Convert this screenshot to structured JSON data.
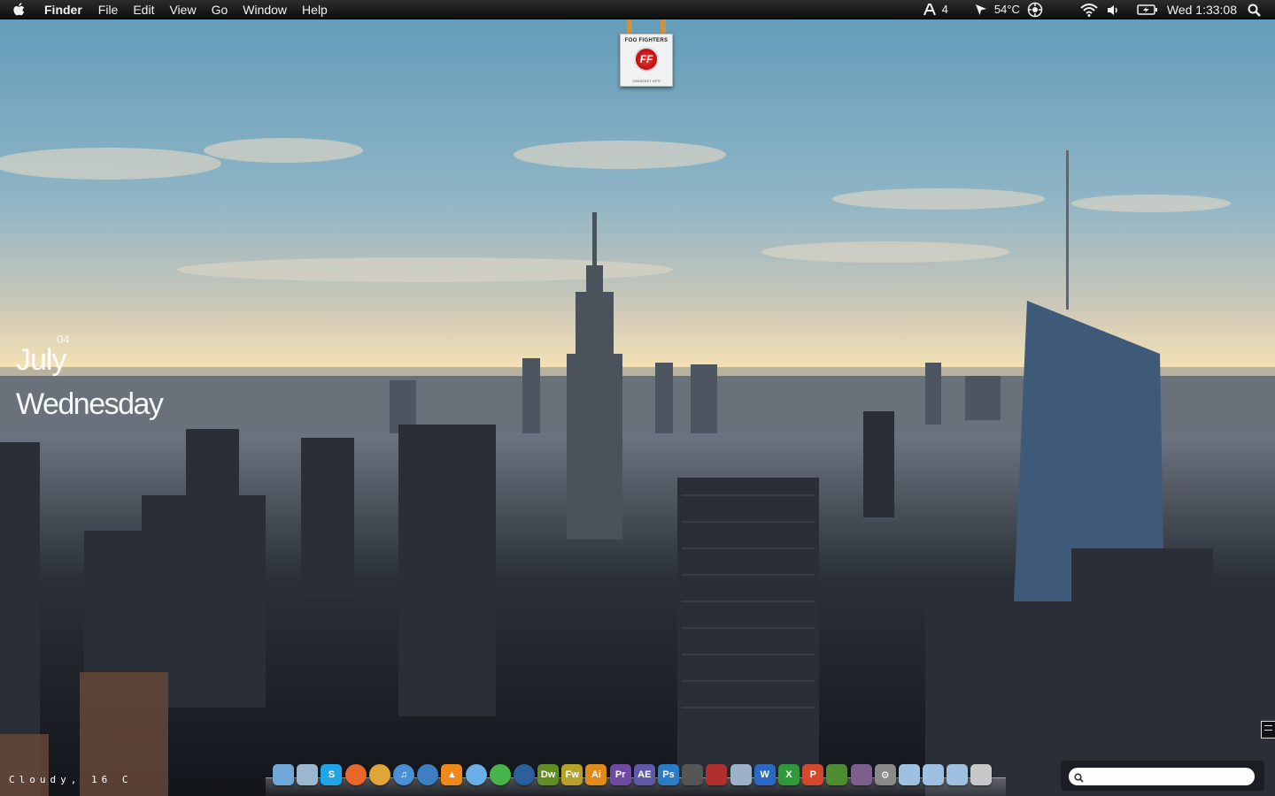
{
  "menubar": {
    "app_name": "Finder",
    "menus": [
      "File",
      "Edit",
      "View",
      "Go",
      "Window",
      "Help"
    ],
    "status": {
      "workspace_count": "4",
      "temperature": "54°C",
      "clock": "Wed 1:33:08"
    },
    "icons": [
      "apple-icon",
      "workspace-icon",
      "cursor-icon",
      "sensor-icon",
      "wifi-icon",
      "volume-icon",
      "battery-icon",
      "spotlight-icon"
    ]
  },
  "album": {
    "band": "FOO FIGHTERS",
    "title": "GREATEST HITS",
    "badge": "FF"
  },
  "date_widget": {
    "month": "July",
    "day": "04",
    "weekday": "Wednesday"
  },
  "weather": {
    "text": "Cloudy, 16 C"
  },
  "dock": {
    "items": [
      {
        "name": "finder",
        "label": "",
        "color": "#6fa7d8"
      },
      {
        "name": "mail",
        "label": "",
        "color": "#9bb6cf"
      },
      {
        "name": "skype",
        "label": "S",
        "color": "#1fa5e8"
      },
      {
        "name": "firefox",
        "label": "",
        "color": "#e7682a"
      },
      {
        "name": "chrome",
        "label": "",
        "color": "#dfa637"
      },
      {
        "name": "itunes",
        "label": "♫",
        "color": "#4a8ed6"
      },
      {
        "name": "safari",
        "label": "",
        "color": "#3d7fc2"
      },
      {
        "name": "vlc",
        "label": "▲",
        "color": "#ef8a1a"
      },
      {
        "name": "cyberduck",
        "label": "",
        "color": "#6ab0e6"
      },
      {
        "name": "facetime",
        "label": "",
        "color": "#46b34b"
      },
      {
        "name": "quicktime",
        "label": "",
        "color": "#2d5f9a"
      },
      {
        "name": "dreamweaver",
        "label": "Dw",
        "color": "#5f8f22"
      },
      {
        "name": "fireworks",
        "label": "Fw",
        "color": "#b6a12a"
      },
      {
        "name": "illustrator",
        "label": "Ai",
        "color": "#e08a1c"
      },
      {
        "name": "premiere",
        "label": "Pr",
        "color": "#6f4aa3"
      },
      {
        "name": "after-effects",
        "label": "AE",
        "color": "#5e5aa8"
      },
      {
        "name": "photoshop",
        "label": "Ps",
        "color": "#2c7bc5"
      },
      {
        "name": "final-cut",
        "label": "",
        "color": "#555555"
      },
      {
        "name": "photo-booth",
        "label": "",
        "color": "#b03030"
      },
      {
        "name": "istat",
        "label": "",
        "color": "#9ab3c8"
      },
      {
        "name": "word",
        "label": "W",
        "color": "#2a69c4"
      },
      {
        "name": "excel",
        "label": "X",
        "color": "#2f9a3a"
      },
      {
        "name": "powerpoint",
        "label": "P",
        "color": "#d4482e"
      },
      {
        "name": "minecraft",
        "label": "",
        "color": "#4d8d2f"
      },
      {
        "name": "automator",
        "label": "",
        "color": "#7c5f8e"
      },
      {
        "name": "system-preferences",
        "label": "⚙",
        "color": "#8a8a8a"
      },
      {
        "name": "folder-applications",
        "label": "",
        "color": "#9ec1e1"
      },
      {
        "name": "folder-documents",
        "label": "",
        "color": "#9ec1e1"
      },
      {
        "name": "folder-downloads",
        "label": "",
        "color": "#9ec1e1"
      },
      {
        "name": "trash",
        "label": "",
        "color": "#c7c7c7"
      }
    ]
  },
  "search": {
    "value": "",
    "placeholder": ""
  }
}
